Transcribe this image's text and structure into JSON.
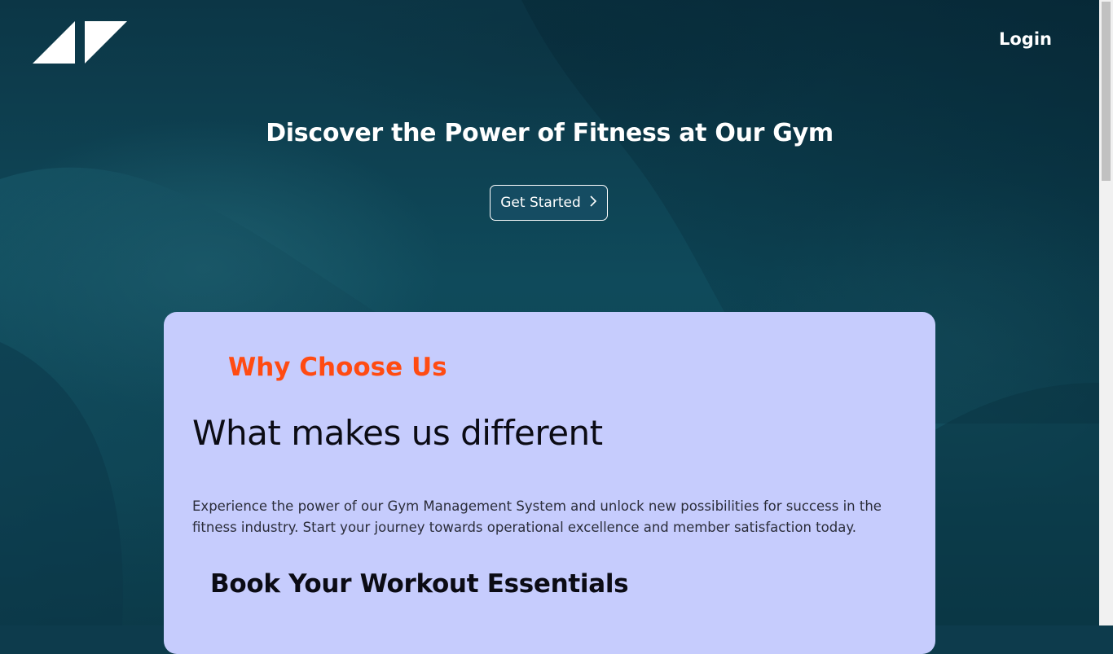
{
  "header": {
    "logo_icon": "brand-logo-icon",
    "login_label": "Login"
  },
  "hero": {
    "title": "Discover the Power of Fitness at Our Gym",
    "cta_label": "Get Started",
    "cta_icon": "chevron-right-icon"
  },
  "why_section": {
    "eyebrow": "Why Choose Us",
    "heading": "What makes us different",
    "body": "Experience the power of our Gym Management System and unlock new possibilities for success in the fitness industry. Start your journey towards operational excellence and member satisfaction today.",
    "subheading": "Book Your Workout Essentials"
  },
  "colors": {
    "hero_bg": "#0d3b4c",
    "card_bg": "#c6ccfd",
    "accent": "#ff4b12",
    "button_bg": "#154c62"
  }
}
